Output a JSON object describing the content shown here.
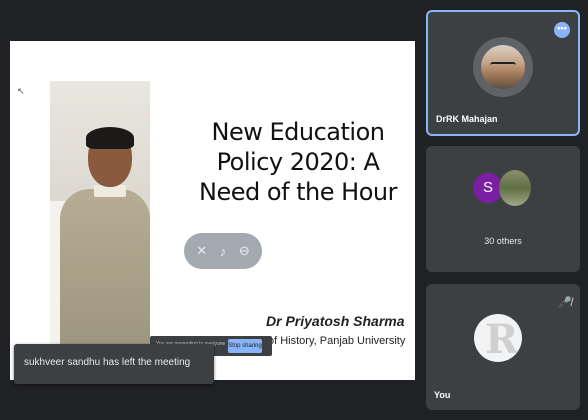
{
  "presentation": {
    "slide_title": "New Education Policy 2020: A Need of the Hour",
    "author": "Dr Priyatosh Sharma",
    "affiliation": "of History, Panjab University"
  },
  "share_bar": {
    "text": "You are presenting to everyone",
    "stop_label": "Stop sharing"
  },
  "toast": {
    "message": "sukhveer sandhu has left the meeting"
  },
  "participants": {
    "tile1": {
      "name": "DrRK Mahajan",
      "more_icon": "more-horiz-icon"
    },
    "tile2": {
      "initial": "S",
      "label": "30 others"
    },
    "tile3": {
      "name": "You",
      "avatar_letter": "R",
      "mic_icon": "mic-off-icon"
    }
  },
  "colors": {
    "background": "#202124",
    "tile": "#3c4043",
    "accent": "#8ab4f8",
    "avatar_purple": "#7b1fa2"
  }
}
